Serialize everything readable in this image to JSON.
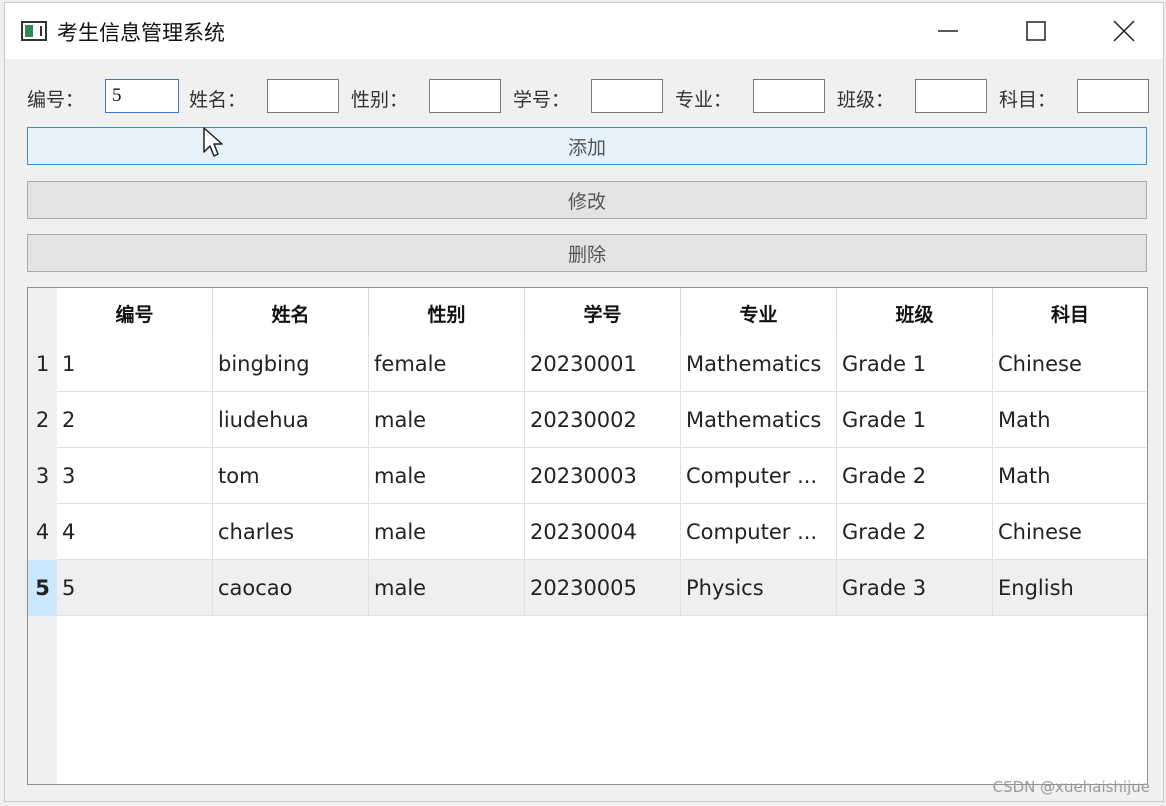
{
  "window": {
    "title": "考生信息管理系统",
    "controls": [
      "minimize-icon",
      "maximize-icon",
      "close-icon"
    ]
  },
  "form": {
    "fields": [
      {
        "label": "编号：",
        "value": "5"
      },
      {
        "label": "姓名：",
        "value": ""
      },
      {
        "label": "性别：",
        "value": ""
      },
      {
        "label": "学号：",
        "value": ""
      },
      {
        "label": "专业：",
        "value": ""
      },
      {
        "label": "班级：",
        "value": ""
      },
      {
        "label": "科目：",
        "value": ""
      }
    ]
  },
  "buttons": {
    "add": "添加",
    "modify": "修改",
    "delete": "删除"
  },
  "table": {
    "headers": [
      "编号",
      "姓名",
      "性别",
      "学号",
      "专业",
      "班级",
      "科目"
    ],
    "rows": [
      {
        "num": "1",
        "cells": [
          "1",
          "bingbing",
          "female",
          "20230001",
          "Mathematics",
          "Grade 1",
          "Chinese"
        ]
      },
      {
        "num": "2",
        "cells": [
          "2",
          "liudehua",
          "male",
          "20230002",
          "Mathematics",
          "Grade 1",
          "Math"
        ]
      },
      {
        "num": "3",
        "cells": [
          "3",
          "tom",
          "male",
          "20230003",
          "Computer ...",
          "Grade 2",
          "Math"
        ]
      },
      {
        "num": "4",
        "cells": [
          "4",
          "charles",
          "male",
          "20230004",
          "Computer ...",
          "Grade 2",
          "Chinese"
        ]
      },
      {
        "num": "5",
        "cells": [
          "5",
          "caocao",
          "male",
          "20230005",
          "Physics",
          "Grade 3",
          "English"
        ]
      }
    ],
    "selected_row": 5
  },
  "watermark": "CSDN @xuehaishijue",
  "colors": {
    "selection": "#cce8ff",
    "hover_button": "#e5f1fb",
    "accent_border": "#3c8cd6"
  }
}
